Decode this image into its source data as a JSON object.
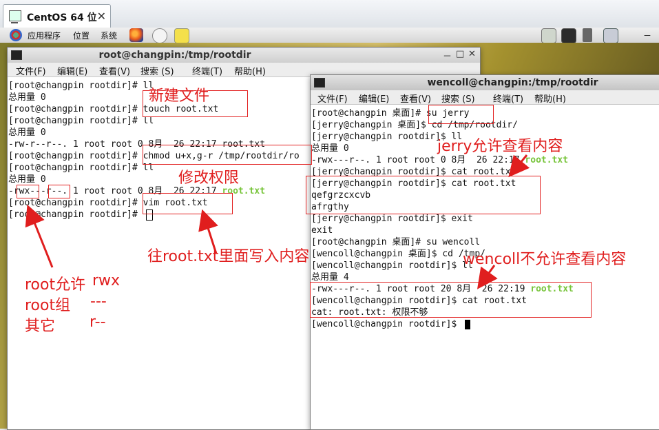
{
  "vm_tab": {
    "title": "CentOS 64 位",
    "close": "✕"
  },
  "panel": {
    "applications": "应用程序",
    "places": "位置",
    "system": "系统",
    "right_dash": "－"
  },
  "left_terminal": {
    "title": "root@changpin:/tmp/rootdir",
    "controls": {
      "min": "－",
      "max": "□",
      "close": "✕"
    },
    "menu": [
      "文件(F)",
      "编辑(E)",
      "查看(V)",
      "搜索 (S)",
      "终端(T)",
      "帮助(H)"
    ],
    "lines": [
      "[root@changpin rootdir]# ll",
      "总用量 0",
      "[root@changpin rootdir]# touch root.txt",
      "[root@changpin rootdir]# ll",
      "总用量 0",
      "-rw-r--r--. 1 root root 0 8月  26 22:17 root.txt",
      "[root@changpin rootdir]# chmod u+x,g-r /tmp/rootdir/ro",
      "[root@changpin rootdir]# ll",
      "总用量 0",
      "-rwx---r--. 1 root root 0 8月  26 22:17 ",
      "[root@changpin rootdir]# vim root.txt",
      "[root@changpin rootdir]# "
    ],
    "green_file": "root.txt"
  },
  "right_terminal": {
    "title": "wencoll@changpin:/tmp/rootdir",
    "menu": [
      "文件(F)",
      "编辑(E)",
      "查看(V)",
      "搜索 (S)",
      "终端(T)",
      "帮助(H)"
    ],
    "lines": [
      "[root@changpin 桌面]# su jerry",
      "[jerry@changpin 桌面]$ cd /tmp/rootdir/",
      "[jerry@changpin rootdir]$ ll",
      "总用量 0",
      "-rwx---r--. 1 root root 0 8月  26 22:17 ",
      "[jerry@changpin rootdir]$ cat root.txt",
      "[jerry@changpin rootdir]$ cat root.txt",
      "qefgrzcxcvb",
      "afrgthy",
      "[jerry@changpin rootdir]$ exit",
      "exit",
      "[root@changpin 桌面]# su wencoll",
      "[wencoll@changpin 桌面]$ cd /tmp/",
      "[wencoll@changpin rootdir]$ ll",
      "总用量 4",
      "-rwx---r--. 1 root root 20 8月  26 22:19 ",
      "[wencoll@changpin rootdir]$ cat root.txt",
      "cat: root.txt: 权限不够",
      "[wencoll@changpin rootdir]$ "
    ],
    "green_file": "root.txt"
  },
  "annotations": {
    "new_file": "新建文件",
    "modify_perm": "修改权限",
    "write_content": "往root.txt里面写入内容",
    "jerry_allowed": "jerry允许查看内容",
    "wencoll_denied": "wencoll不允许查看内容",
    "perm_legend": {
      "root_allowed": "root允许",
      "root_group": "root组",
      "others": "其它",
      "rwx": "rwx",
      "none": "---",
      "r": "r--"
    }
  }
}
